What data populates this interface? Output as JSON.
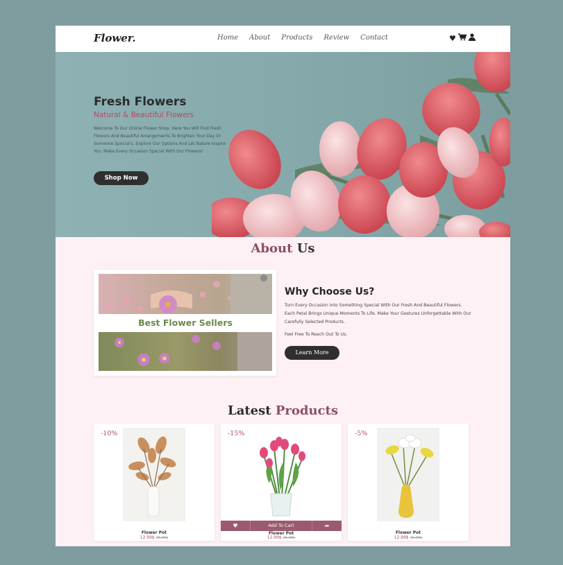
{
  "header": {
    "logo": "Flower.",
    "nav": [
      "Home",
      "About",
      "Products",
      "Review",
      "Contact"
    ],
    "icons": [
      "heart-icon",
      "cart-icon",
      "user-icon"
    ]
  },
  "hero": {
    "title": "Fresh Flowers",
    "subtitle": "Natural & Beautiful Flowers",
    "description": "Welcome To Our Online Flower Shop. Here You Will Find Fresh Flowers And Beautiful Arrangements To Brighten Your Day Or Someone Special's. Explore Our Options And Let Nature Inspire You. Make Every Occasion Special With Our Flowers!",
    "button": "Shop Now"
  },
  "about": {
    "title_part1": "About",
    "title_part2": " Us",
    "image_caption": "Best Flower Sellers",
    "why_title": "Why Choose Us?",
    "why_desc": "Turn Every Occasion Into Something Special With Our Fresh And Beautiful Flowers. Each Petal Brings Unique Moments To Life. Make Your Gestures Unforgettable With Our Carefully Selected Products.",
    "why_note": "Feel Free To Reach Out To Us.",
    "button": "Learn More"
  },
  "products": {
    "title_part1": "Latest ",
    "title_part2": "Products",
    "items": [
      {
        "badge": "-10%",
        "name": "Flower Pot",
        "price": "12.99$",
        "old_price": "15.99$"
      },
      {
        "badge": "-15%",
        "name": "Flower Pot",
        "price": "12.99$",
        "old_price": "15.99$",
        "add_to_cart": "Add To Cart"
      },
      {
        "badge": "-5%",
        "name": "Flower Pot",
        "price": "12.99$",
        "old_price": "15.99$"
      }
    ]
  },
  "colors": {
    "accent": "#8d4d63",
    "hero_bg": "#86aaac",
    "page_bg": "#fdf1f5",
    "button_dark": "#2f2f2f"
  }
}
